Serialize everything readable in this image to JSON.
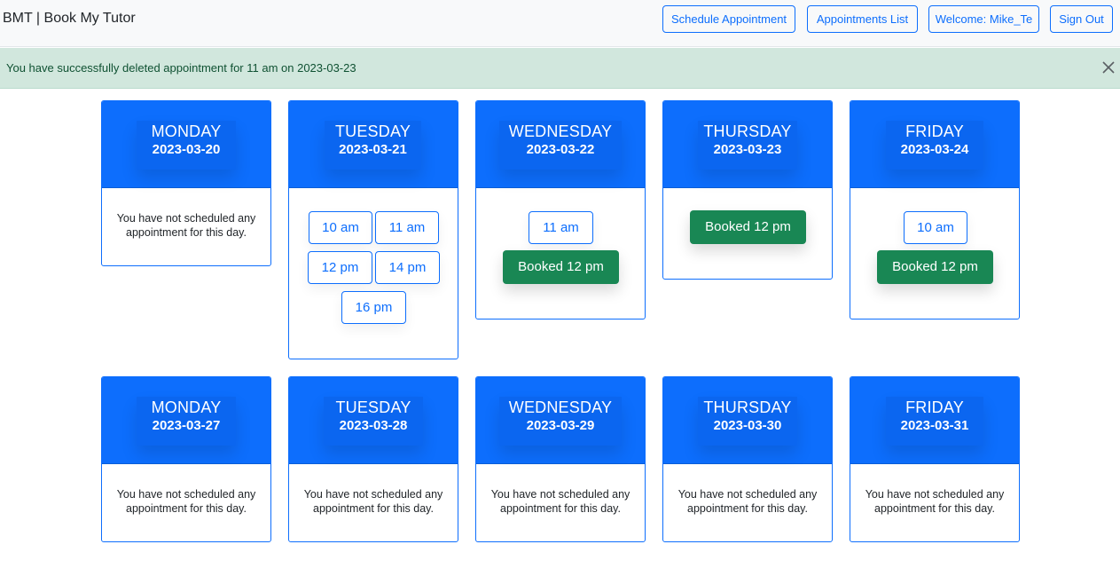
{
  "navbar": {
    "brand": "BMT | Book My Tutor",
    "schedule_label": "Schedule Appointment",
    "list_label": "Appointments List",
    "welcome_label": "Welcome: Mike_Te",
    "signout_label": "Sign Out"
  },
  "alert": {
    "message": "You have successfully deleted appointment for 11 am on 2023-03-23",
    "close_icon": "close-icon"
  },
  "empty_message": "You have not scheduled any appointment for this day.",
  "weeks": [
    {
      "days": [
        {
          "name": "MONDAY",
          "date": "2023-03-20",
          "slots": [],
          "booked": []
        },
        {
          "name": "TUESDAY",
          "date": "2023-03-21",
          "slots": [
            "10 am",
            "11 am",
            "12 pm",
            "14 pm",
            "16 pm"
          ],
          "booked": []
        },
        {
          "name": "WEDNESDAY",
          "date": "2023-03-22",
          "slots": [
            "11 am"
          ],
          "booked": [
            "Booked 12 pm"
          ]
        },
        {
          "name": "THURSDAY",
          "date": "2023-03-23",
          "slots": [],
          "booked": [
            "Booked 12 pm"
          ]
        },
        {
          "name": "FRIDAY",
          "date": "2023-03-24",
          "slots": [
            "10 am"
          ],
          "booked": [
            "Booked 12 pm"
          ]
        }
      ]
    },
    {
      "days": [
        {
          "name": "MONDAY",
          "date": "2023-03-27",
          "slots": [],
          "booked": []
        },
        {
          "name": "TUESDAY",
          "date": "2023-03-28",
          "slots": [],
          "booked": []
        },
        {
          "name": "WEDNESDAY",
          "date": "2023-03-29",
          "slots": [],
          "booked": []
        },
        {
          "name": "THURSDAY",
          "date": "2023-03-30",
          "slots": [],
          "booked": []
        },
        {
          "name": "FRIDAY",
          "date": "2023-03-31",
          "slots": [],
          "booked": []
        }
      ]
    }
  ],
  "colors": {
    "primary": "#0d6efd",
    "success": "#198754",
    "alert_bg": "#d1e7dd",
    "navbar_bg": "#f8f9fa"
  }
}
